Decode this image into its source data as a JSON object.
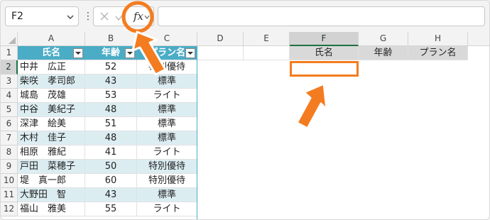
{
  "formula_bar": {
    "name_box": "F2",
    "fx_label": "fx",
    "formula": "",
    "separator": "⋮"
  },
  "columns": [
    "A",
    "B",
    "C",
    "D",
    "E",
    "F",
    "G",
    "H"
  ],
  "selected_column": "F",
  "rows": [
    "1",
    "2",
    "3",
    "4",
    "5",
    "6",
    "7",
    "8",
    "9",
    "10",
    "11",
    "12"
  ],
  "selected_row": "2",
  "table": {
    "headers": [
      "氏名",
      "年齢",
      "プラン名"
    ],
    "rows": [
      [
        "中井　広正",
        "52",
        "特別優待"
      ],
      [
        "柴咲　孝司郎",
        "43",
        "標準"
      ],
      [
        "城島　茂雄",
        "53",
        "ライト"
      ],
      [
        "中谷　美紀子",
        "48",
        "標準"
      ],
      [
        "深津　絵美",
        "51",
        "標準"
      ],
      [
        "木村　佳子",
        "48",
        "標準"
      ],
      [
        "相原　雅紀",
        "41",
        "ライト"
      ],
      [
        "戸田　菜穂子",
        "50",
        "特別優待"
      ],
      [
        "堤　真一郎",
        "60",
        "特別優待"
      ],
      [
        "大野田　智",
        "43",
        "標準"
      ],
      [
        "福山　雅美",
        "55",
        "ライト"
      ]
    ]
  },
  "lookup_headers": [
    "氏名",
    "年齢",
    "プラン名"
  ],
  "colors": {
    "table_header": "#4bacc6",
    "table_band": "#dcedf2",
    "annotation": "#f47c20",
    "selection": "#1f7244"
  }
}
